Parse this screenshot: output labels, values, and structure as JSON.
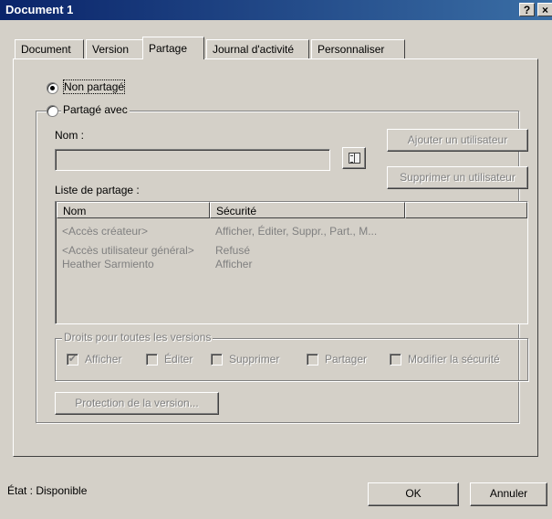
{
  "window": {
    "title": "Document 1",
    "help": "?",
    "close": "×"
  },
  "tabs": [
    {
      "label": "Document"
    },
    {
      "label": "Version"
    },
    {
      "label": "Partage"
    },
    {
      "label": "Journal d'activité"
    },
    {
      "label": "Personnaliser"
    }
  ],
  "sharing": {
    "not_shared_label": "Non partagé",
    "shared_with_label": "Partagé avec",
    "name_label": "Nom :",
    "name_value": "",
    "add_user": "Ajouter un utilisateur",
    "remove_user": "Supprimer un utilisateur",
    "list_label": "Liste de partage :",
    "columns": [
      "Nom",
      "Sécurité"
    ],
    "rows": [
      {
        "name": "<Accès créateur>",
        "security": "Afficher, Éditer, Suppr., Part., M..."
      },
      {
        "name": "<Accès utilisateur général>",
        "security": "Refusé"
      },
      {
        "name": "Heather Sarmiento",
        "security": "Afficher"
      }
    ],
    "rights_group_title": "Droits pour toutes les versions",
    "rights": {
      "view": "Afficher",
      "edit": "Éditer",
      "delete": "Supprimer",
      "share": "Partager",
      "modify_security": "Modifier la sécurité"
    },
    "version_protection": "Protection de la version..."
  },
  "status": {
    "text": "État : Disponible"
  },
  "buttons": {
    "ok": "OK",
    "cancel": "Annuler"
  }
}
